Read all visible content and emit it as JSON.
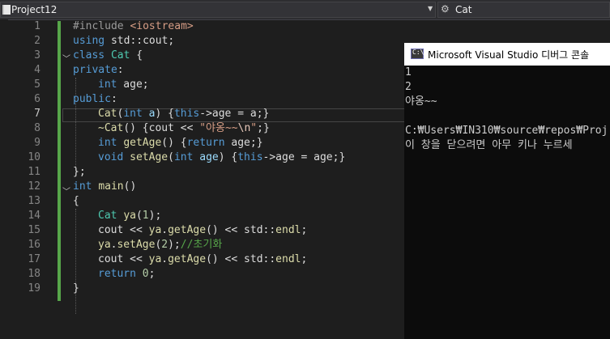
{
  "navbar": {
    "project": "Project12",
    "symbol": "Cat"
  },
  "editor": {
    "line_numbers": [
      "1",
      "2",
      "3",
      "4",
      "5",
      "6",
      "7",
      "8",
      "9",
      "10",
      "11",
      "12",
      "13",
      "14",
      "15",
      "16",
      "17",
      "18",
      "19"
    ],
    "current_line": 7,
    "code": {
      "l1_pre": "#include ",
      "l1_inc": "<iostream>",
      "l2_kw": "using",
      "l2_rest": " std::cout;",
      "l3_kw": "class",
      "l3_type": "Cat",
      "l3_brace": " {",
      "l4_kw": "private",
      "l4_colon": ":",
      "l5_kw": "int",
      "l5_rest": " age;",
      "l6_kw": "public",
      "l6_colon": ":",
      "l7_fn": "Cat",
      "l7_p1": "(",
      "l7_kw": "int",
      "l7_param": " a",
      "l7_p2": ") {",
      "l7_this": "this",
      "l7_rest": "->age = a;}",
      "l8_dtor": "~Cat",
      "l8_p1": "() {cout << ",
      "l8_str": "\"야옹~~",
      "l8_esc": "\\n",
      "l8_str2": "\"",
      "l8_end": ";}",
      "l9_kw": "int",
      "l9_sp": " ",
      "l9_fn": "getAge",
      "l9_p": "() {",
      "l9_ret": "return",
      "l9_rest": " age;}",
      "l10_kw": "void",
      "l10_sp": " ",
      "l10_fn": "setAge",
      "l10_p1": "(",
      "l10_kw2": "int",
      "l10_param": " age",
      "l10_p2": ") {",
      "l10_this": "this",
      "l10_rest": "->age = age;}",
      "l11": "};",
      "l12_kw": "int",
      "l12_sp": " ",
      "l12_fn": "main",
      "l12_rest": "()",
      "l13": "{",
      "l14_type": "Cat",
      "l14_sp": " ",
      "l14_fn": "ya",
      "l14_p1": "(",
      "l14_num": "1",
      "l14_p2": ");",
      "l15_a": "cout << ",
      "l15_var": "ya",
      "l15_dot": ".",
      "l15_fn": "getAge",
      "l15_rest": "() << std::",
      "l15_endl": "endl",
      "l15_semi": ";",
      "l16_var": "ya",
      "l16_dot": ".",
      "l16_fn": "setAge",
      "l16_p1": "(",
      "l16_num": "2",
      "l16_p2": ");",
      "l16_cmt": "//초기화",
      "l17_a": "cout << ",
      "l17_var": "ya",
      "l17_dot": ".",
      "l17_fn": "getAge",
      "l17_rest": "() << std::",
      "l17_endl": "endl",
      "l17_semi": ";",
      "l18_kw": "return",
      "l18_sp": " ",
      "l18_num": "0",
      "l18_semi": ";",
      "l19": "}"
    }
  },
  "console": {
    "title": "Microsoft Visual Studio 디버그 콘솔",
    "lines": [
      "1",
      "2",
      "야옹~~",
      "",
      "C:₩Users₩IN310₩source₩repos₩Proj",
      "이 창을 닫으려면 아무 키나 누르세"
    ]
  },
  "colors": {
    "editor_bg": "#1e1e1e",
    "keyword": "#569cd6",
    "type": "#4ec9b0",
    "function": "#dcdcaa",
    "string": "#d69d85",
    "comment": "#57a64a",
    "change_bar": "#57a64a",
    "console_bg": "#0c0c0c"
  },
  "icons": {
    "project": "cpp-project-icon",
    "symbol": "class-symbol-icon",
    "console": "console-app-icon"
  }
}
